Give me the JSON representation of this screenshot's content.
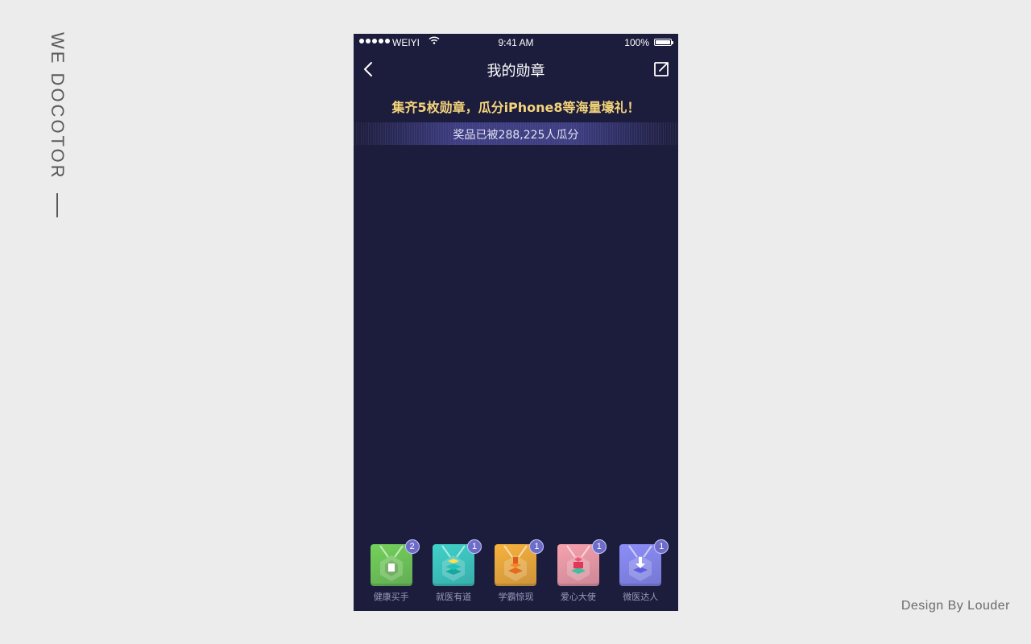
{
  "side_title": "WE DOCOTOR",
  "credit": "Design By Louder",
  "status_bar": {
    "carrier": "WEIYI",
    "time": "9:41 AM",
    "battery": "100%"
  },
  "nav": {
    "title": "我的勋章"
  },
  "promo": {
    "headline": "集齐5枚勋章，瓜分iPhone8等海量壕礼！",
    "stat": "奖品已被288,225人瓜分"
  },
  "colors": {
    "background": "#1c1c3c",
    "promo_text": "#f4d47a"
  },
  "badges": [
    {
      "label": "健康买手",
      "count": "2",
      "color": "#74d15a",
      "icon": "medicine-bag-icon"
    },
    {
      "label": "就医有道",
      "count": "1",
      "color": "#3fd2c8",
      "icon": "layers-icon"
    },
    {
      "label": "学霸惊现",
      "count": "1",
      "color": "#f8b23c",
      "icon": "books-icon"
    },
    {
      "label": "爱心大使",
      "count": "1",
      "color": "#f7a2ad",
      "icon": "heart-gift-icon"
    },
    {
      "label": "微医达人",
      "count": "1",
      "color": "#8c8ef8",
      "icon": "download-icon"
    }
  ]
}
